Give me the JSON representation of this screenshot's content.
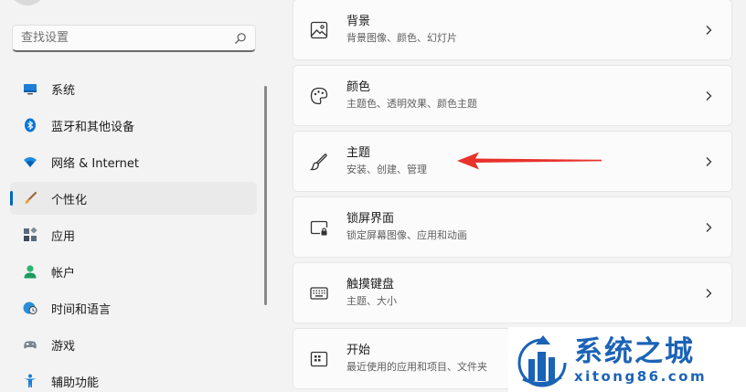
{
  "search": {
    "placeholder": "查找设置"
  },
  "nav": {
    "items": [
      {
        "label": "系统",
        "icon": "monitor-icon"
      },
      {
        "label": "蓝牙和其他设备",
        "icon": "bluetooth-icon"
      },
      {
        "label": "网络 & Internet",
        "icon": "wifi-icon"
      },
      {
        "label": "个性化",
        "icon": "paintbrush-icon",
        "active": true
      },
      {
        "label": "应用",
        "icon": "apps-icon"
      },
      {
        "label": "帐户",
        "icon": "person-icon"
      },
      {
        "label": "时间和语言",
        "icon": "globe-clock-icon"
      },
      {
        "label": "游戏",
        "icon": "gamepad-icon"
      },
      {
        "label": "辅助功能",
        "icon": "accessibility-icon"
      }
    ]
  },
  "cards": [
    {
      "title": "背景",
      "subtitle": "背景图像、颜色、幻灯片",
      "icon": "image-icon"
    },
    {
      "title": "颜色",
      "subtitle": "主题色、透明效果、颜色主题",
      "icon": "palette-icon"
    },
    {
      "title": "主题",
      "subtitle": "安装、创建、管理",
      "icon": "brush-icon"
    },
    {
      "title": "锁屏界面",
      "subtitle": "锁定屏幕图像、应用和动画",
      "icon": "lock-screen-icon"
    },
    {
      "title": "触摸键盘",
      "subtitle": "主题、大小",
      "icon": "keyboard-icon"
    },
    {
      "title": "开始",
      "subtitle": "最近使用的应用和项目、文件夹",
      "icon": "start-menu-icon"
    }
  ],
  "watermark": {
    "title": "系统之城",
    "url": "xitong86.com"
  },
  "colors": {
    "accent": "#0067c0",
    "annotation_arrow": "#e8322b",
    "watermark": "#1b63b6"
  }
}
